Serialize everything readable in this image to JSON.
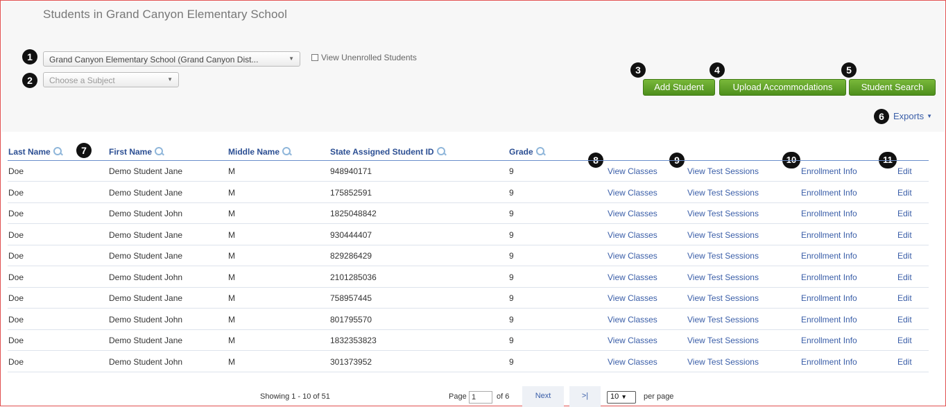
{
  "page_title": "Students in Grand Canyon Elementary School",
  "filters": {
    "school_select": "Grand Canyon Elementary School (Grand Canyon Dist...",
    "subject_select_placeholder": "Choose a Subject",
    "view_unenrolled_label": "View Unenrolled Students",
    "view_unenrolled_checked": false
  },
  "actions": {
    "add_student": "Add Student",
    "upload_accommodations": "Upload Accommodations",
    "student_search": "Student Search",
    "exports": "Exports"
  },
  "callouts": [
    "1",
    "2",
    "3",
    "4",
    "5",
    "6",
    "7",
    "8",
    "9",
    "10",
    "11"
  ],
  "table": {
    "columns": [
      "Last Name",
      "First Name",
      "Middle Name",
      "State Assigned Student ID",
      "Grade"
    ],
    "rows": [
      {
        "last": "Doe",
        "first": "Demo Student Jane",
        "middle": "M",
        "id": "948940171",
        "grade": "9"
      },
      {
        "last": "Doe",
        "first": "Demo Student Jane",
        "middle": "M",
        "id": "175852591",
        "grade": "9"
      },
      {
        "last": "Doe",
        "first": "Demo Student John",
        "middle": "M",
        "id": "1825048842",
        "grade": "9"
      },
      {
        "last": "Doe",
        "first": "Demo Student Jane",
        "middle": "M",
        "id": "930444407",
        "grade": "9"
      },
      {
        "last": "Doe",
        "first": "Demo Student Jane",
        "middle": "M",
        "id": "829286429",
        "grade": "9"
      },
      {
        "last": "Doe",
        "first": "Demo Student John",
        "middle": "M",
        "id": "2101285036",
        "grade": "9"
      },
      {
        "last": "Doe",
        "first": "Demo Student Jane",
        "middle": "M",
        "id": "758957445",
        "grade": "9"
      },
      {
        "last": "Doe",
        "first": "Demo Student John",
        "middle": "M",
        "id": "801795570",
        "grade": "9"
      },
      {
        "last": "Doe",
        "first": "Demo Student Jane",
        "middle": "M",
        "id": "1832353823",
        "grade": "9"
      },
      {
        "last": "Doe",
        "first": "Demo Student John",
        "middle": "M",
        "id": "301373952",
        "grade": "9"
      }
    ],
    "row_links": {
      "view_classes": "View Classes",
      "view_test_sessions": "View Test Sessions",
      "enrollment_info": "Enrollment Info",
      "edit": "Edit"
    }
  },
  "pagination": {
    "showing": "Showing 1 - 10 of 51",
    "page_label": "Page",
    "page_value": "1",
    "of_pages": "of 6",
    "next": "Next",
    "last": ">|",
    "per_page_value": "10",
    "per_page_label": "per page"
  },
  "colors": {
    "accent_green": "#5a9e24",
    "link_blue": "#3a5ea8",
    "header_blue": "#2c4f93",
    "frame_red": "#e05050"
  }
}
